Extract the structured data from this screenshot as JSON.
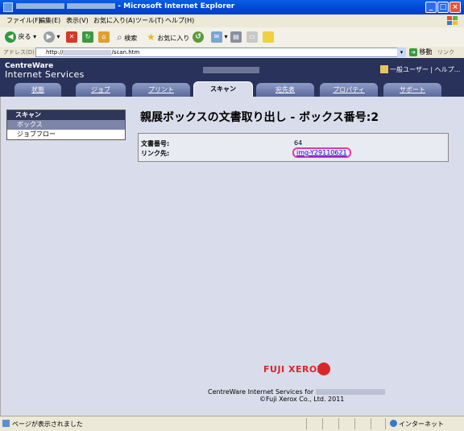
{
  "window": {
    "title": "- Microsoft Internet Explorer",
    "buttons": [
      "_",
      "□",
      "×"
    ]
  },
  "menu": [
    "ファイル(F)",
    "編集(E)",
    "表示(V)",
    "お気に入り(A)",
    "ツール(T)",
    "ヘルプ(H)"
  ],
  "toolbar": {
    "back": "戻る",
    "search": "検索",
    "favorites": "お気に入り"
  },
  "address": {
    "label": "アドレス(D)",
    "url_prefix": "http://",
    "url_suffix": "/scan.htm",
    "go": "移動",
    "links": "リンク"
  },
  "header": {
    "logo_line1": "CentreWare",
    "logo_line2": "Internet Services",
    "user_link": "一般ユーザー | ヘルプ..."
  },
  "tabs": [
    {
      "label": "状態"
    },
    {
      "label": "ジョブ"
    },
    {
      "label": "プリント"
    },
    {
      "label": "スキャン"
    },
    {
      "label": "宛先表"
    },
    {
      "label": "プロパティ"
    },
    {
      "label": "サポート"
    }
  ],
  "sidebar": {
    "heading": "スキャン",
    "items": [
      "ボックス",
      "ジョブフロー"
    ]
  },
  "main": {
    "title": "親展ボックスの文書取り出し - ボックス番号:2",
    "doc_number_label": "文書番号:",
    "doc_number_value": "64",
    "link_label": "リンク先:",
    "link_value": "img-Y29110621"
  },
  "footer": {
    "brand": "FUJI XEROX",
    "line1": "CentreWare Internet Services for",
    "line2": "©Fuji Xerox Co., Ltd. 2011"
  },
  "status": {
    "message": "ページが表示されました",
    "zone": "インターネット"
  },
  "colors": {
    "header_bg": "#29325a",
    "content_bg": "#d9dcea",
    "link_highlight": "#e33aa8",
    "brand_red": "#d9262a"
  }
}
